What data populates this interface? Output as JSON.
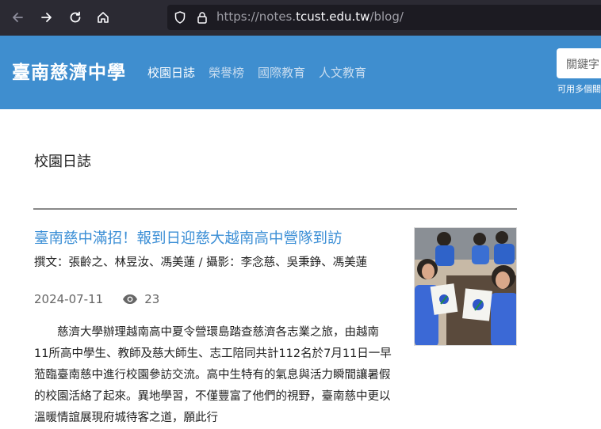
{
  "browser": {
    "url_prefix": "https://notes.",
    "url_domain": "tcust.edu.tw",
    "url_suffix": "/blog/"
  },
  "header": {
    "site_title": "臺南慈濟中學",
    "nav": [
      {
        "label": "校園日誌",
        "active": true
      },
      {
        "label": "榮譽榜",
        "active": false
      },
      {
        "label": "國際教育",
        "active": false
      },
      {
        "label": "人文教育",
        "active": false
      }
    ],
    "search_placeholder": "關鍵字",
    "search_hint": "可用多個關"
  },
  "main": {
    "heading": "校園日誌",
    "post": {
      "title": "臺南慈中滿招！報到日迎慈大越南高中營隊到訪",
      "authors": "撰文：張齡之、林昱汝、馮美蓮 / 攝影：李念慈、吳秉錚、馮美蓮",
      "date": "2024-07-11",
      "views": "23",
      "body": "慈濟大學辦理越南高中夏令營環島踏查慈濟各志業之旅，由越南11所高中學生、教師及慈大師生、志工陪同共計112名於7月11日一早蒞臨臺南慈中進行校園參訪交流。高中生特有的氣息與活力瞬間讓暑假的校園活絡了起來。異地學習，不僅豐富了他們的視野，臺南慈中更以溫暖情誼展現府城待客之道，願此行"
    }
  },
  "colors": {
    "header_bg": "#3f8ecf",
    "link": "#3c8fd6",
    "browser_bg": "#2b2a33"
  }
}
